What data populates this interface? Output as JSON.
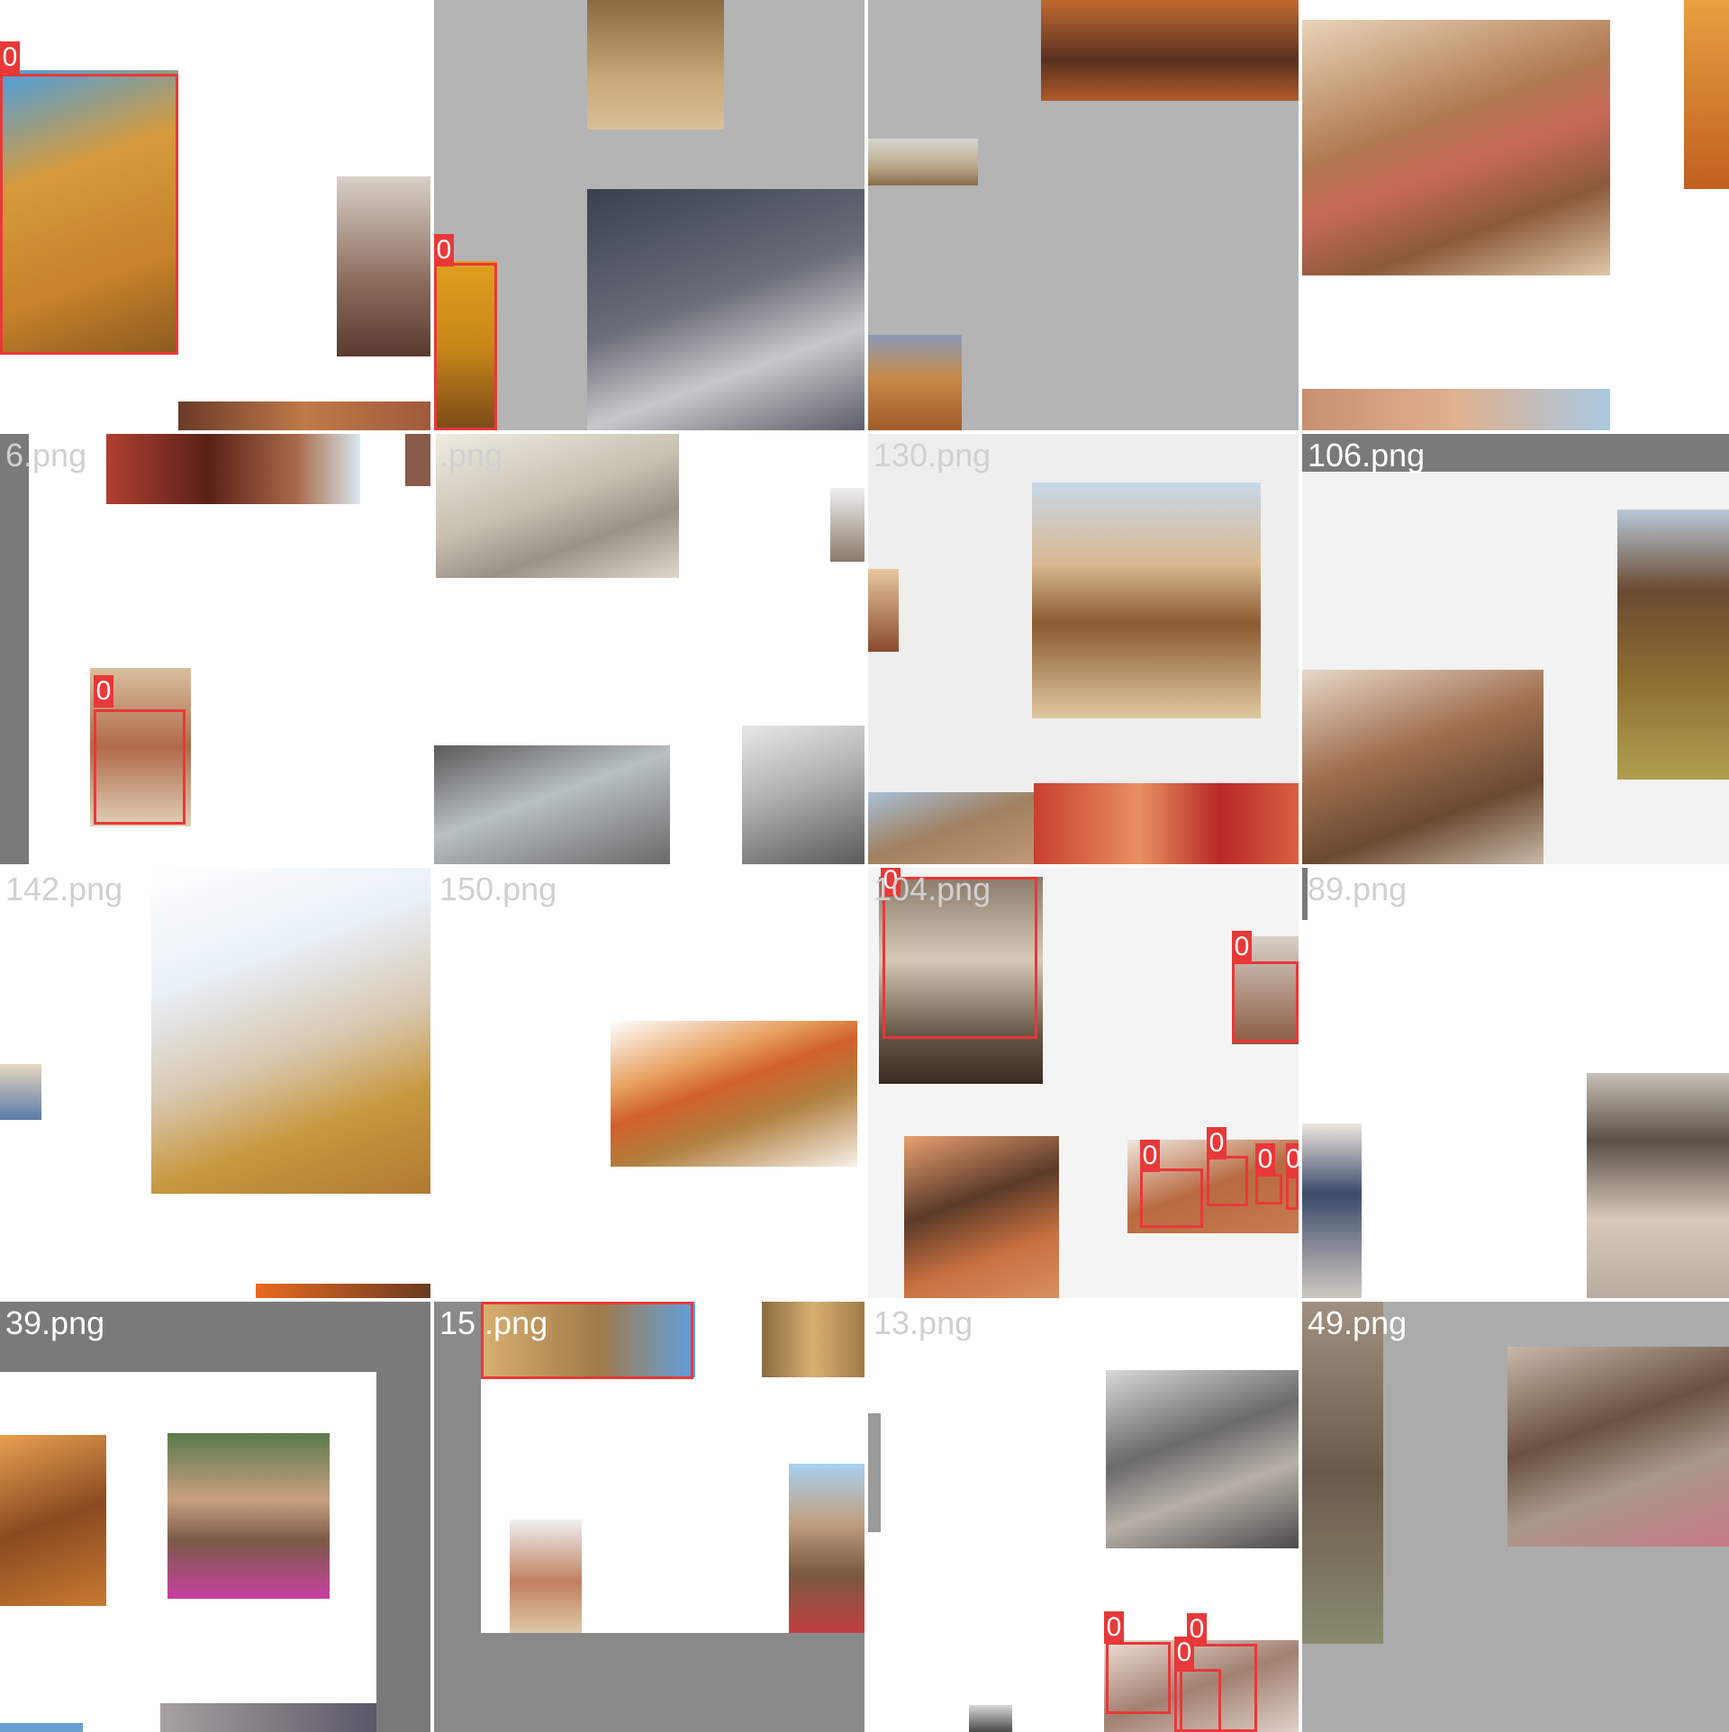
{
  "mosaic": {
    "tiles": [
      {
        "label": ""
      },
      {
        "label": ""
      },
      {
        "label": ""
      },
      {
        "label": ""
      },
      {
        "label": "6.png"
      },
      {
        "label": ".png"
      },
      {
        "label": "130.png"
      },
      {
        "label": "106.png"
      },
      {
        "label": "142.png"
      },
      {
        "label": "150.png"
      },
      {
        "label": "104.png"
      },
      {
        "label": "89.png"
      },
      {
        "label": "39.png"
      },
      {
        "label": "15 .png"
      },
      {
        "label": "13.png"
      },
      {
        "label": "49.png"
      }
    ],
    "detection_class": "0",
    "colors": {
      "box": "#e83838",
      "gray_pad": "#b4b4b4",
      "dark_pad": "#7a7a7a"
    }
  }
}
